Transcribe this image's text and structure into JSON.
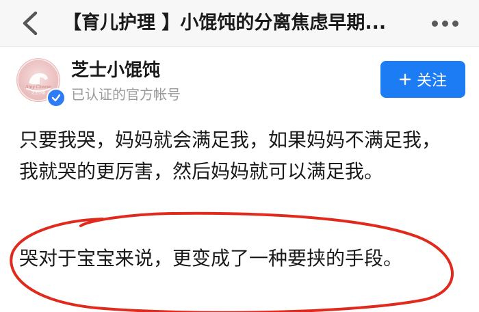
{
  "nav": {
    "title": "【育儿护理 】小馄饨的分离焦虑早期..."
  },
  "account": {
    "name": "芝士小馄饨",
    "subtitle": "已认证的官方帐号",
    "follow_label": "关注",
    "follow_icon": "plus-icon",
    "verified_icon": "check-icon",
    "avatar_text": "Amy Cheese 芝士小馄"
  },
  "article": {
    "paragraph1_lines": [
      "只要我哭，妈妈就会满足我，如果妈妈不满足我，",
      "我就哭的更厉害，然后妈妈就可以满足我。"
    ],
    "paragraph2": "哭对于宝宝来说，更变成了一种要挟的手段。"
  },
  "colors": {
    "accent": "#1c7cf4",
    "annotation": "#e02a1e",
    "secondary_text": "#9a9a9a"
  }
}
